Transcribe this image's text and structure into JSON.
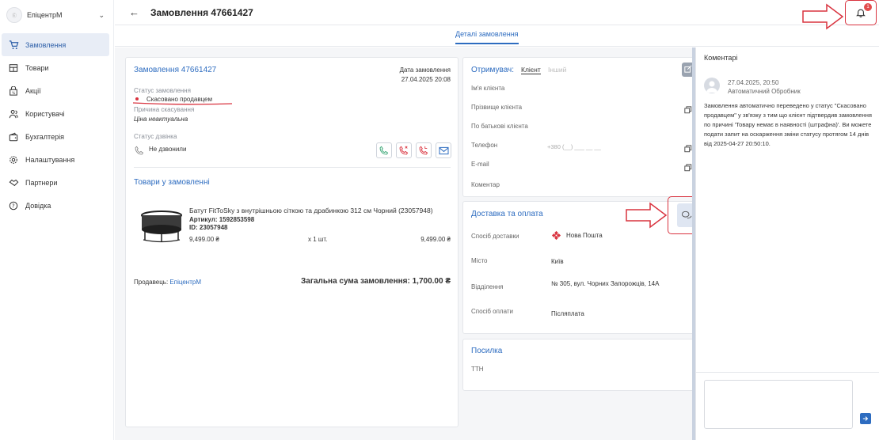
{
  "sidebar": {
    "company": "ЕпіцентрМ",
    "items": [
      {
        "label": "Замовлення",
        "icon": "cart-icon",
        "active": true
      },
      {
        "label": "Товари",
        "icon": "catalog-icon",
        "active": false
      },
      {
        "label": "Акції",
        "icon": "promo-icon",
        "active": false
      },
      {
        "label": "Користувачі",
        "icon": "users-icon",
        "active": false
      },
      {
        "label": "Бухгалтерія",
        "icon": "wallet-icon",
        "active": false
      },
      {
        "label": "Налаштування",
        "icon": "gear-icon",
        "active": false
      },
      {
        "label": "Партнери",
        "icon": "handshake-icon",
        "active": false
      },
      {
        "label": "Довідка",
        "icon": "help-icon",
        "active": false
      }
    ]
  },
  "header": {
    "title": "Замовлення 47661427",
    "notification_count": "1"
  },
  "tabs": {
    "details": "Деталі замовлення"
  },
  "order": {
    "number_label": "Замовлення 47661427",
    "date_label": "Дата замовлення",
    "date_value": "27.04.2025 20:08",
    "status_label": "Статус замовлення",
    "status_value": "Скасовано продавцем",
    "cancel_reason_label": "Причина скасування",
    "cancel_reason_value": "Ціна неактуальна",
    "call_status_label": "Статус дзвінка",
    "call_status_value": "Не дзвонили",
    "products_title": "Товари у замовленні",
    "product": {
      "name": "Батут FitToSky з внутрішньою сіткою та драбинкою 312 см Чорний (23057948)",
      "article": "Артикул: 1592853598",
      "id": "ID: 23057948",
      "price": "9,499.00 ₴",
      "qty": "x 1 шт.",
      "total": "9,499.00 ₴"
    },
    "seller_label": "Продавець:",
    "seller_value": "ЕпіцентрМ",
    "sum_label": "Загальна сума замовлення: 1,700.00 ₴"
  },
  "recipient": {
    "title": "Отримувач:",
    "tab_client": "Клієнт",
    "tab_other": "Інший",
    "first_name": "Ім'я клієнта",
    "last_name": "Прізвище клієнта",
    "middle_name": "По батькові клієнта",
    "phone_label": "Телефон",
    "phone_placeholder": "+380 (__) ___ __ __",
    "email_label": "E-mail",
    "comment_label": "Коментар"
  },
  "delivery": {
    "title": "Доставка та оплата",
    "method_label": "Спосіб доставки",
    "method_value": "Нова Пошта",
    "city_label": "Місто",
    "city_value": "Київ",
    "branch_label": "Відділення",
    "branch_value": "№ 305, вул. Чорних Запорожців, 14А",
    "payment_label": "Спосіб оплати",
    "payment_value": "Післяплата"
  },
  "parcel": {
    "title": "Посилка",
    "ttn_label": "ТТН"
  },
  "comments": {
    "title": "Коментарі",
    "date": "27.04.2025, 20:50",
    "author": "Автоматичний Обробник",
    "text": "Замовлення автоматично переведено у статус \"Скасовано продавцем\" у зв'язку з тим що клієнт підтвердив замовлення по причині 'Товару немає в наявності (штрафна)'. Ви можете подати запит на оскарження зміни статусу протягом 14 днів від 2025-04-27 20:50:10."
  },
  "colors": {
    "accent": "#2d6cc0",
    "status_red": "#d9333f",
    "annotation_red": "#d9333f"
  }
}
